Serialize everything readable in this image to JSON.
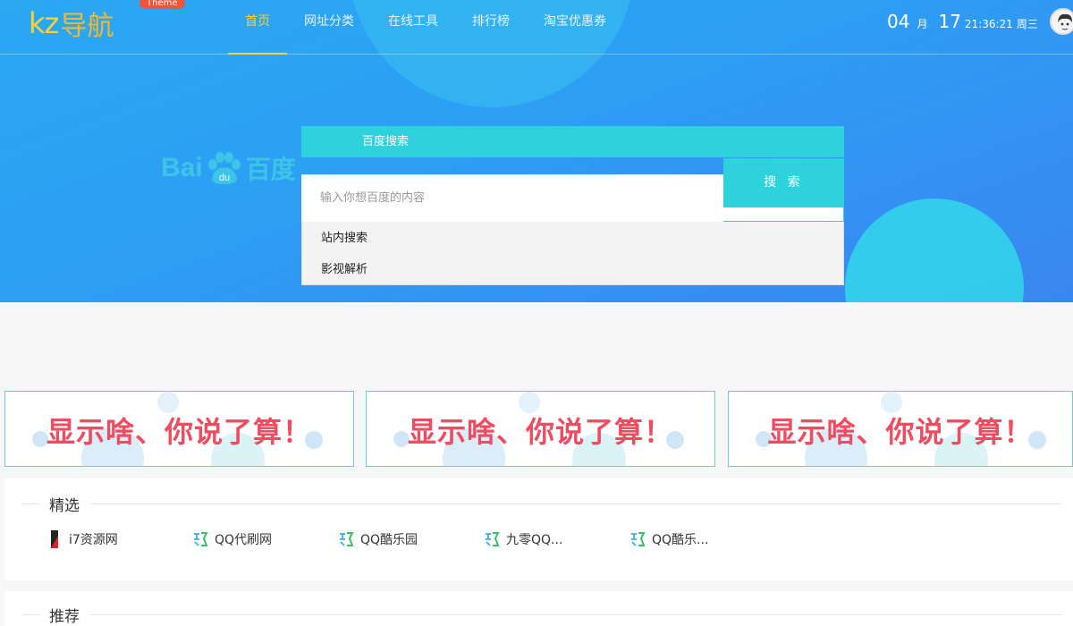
{
  "header": {
    "logo_latin": "kz",
    "logo_cn": "导航",
    "logo_badge": "Theme",
    "nav": [
      {
        "label": "首页",
        "active": true
      },
      {
        "label": "网址分类",
        "active": false
      },
      {
        "label": "在线工具",
        "active": false
      },
      {
        "label": "排行榜",
        "active": false
      },
      {
        "label": "淘宝优惠券",
        "active": false
      }
    ],
    "date": {
      "month": "04",
      "month_unit": "月",
      "day": "17",
      "time": "21:36:21",
      "weekday": "周三"
    }
  },
  "search": {
    "engine_logo_latin": "Bai",
    "engine_logo_du": "du",
    "engine_logo_cn": "百度",
    "active_tab": "百度搜索",
    "placeholder": "输入你想百度的内容",
    "button_label": "搜 索",
    "dropdown": [
      "站内搜索",
      "影视解析"
    ]
  },
  "banners": [
    {
      "text": "显示啥、你说了算！"
    },
    {
      "text": "显示啥、你说了算！"
    },
    {
      "text": "显示啥、你说了算！"
    }
  ],
  "sections": [
    {
      "title": "精选",
      "links": [
        {
          "label": "i7资源网",
          "icon": "i7-logo-icon"
        },
        {
          "label": "QQ代刷网",
          "icon": "ku-logo-icon"
        },
        {
          "label": "QQ酷乐园",
          "icon": "ku-logo-icon"
        },
        {
          "label": "九零QQ...",
          "icon": "ku-logo-icon"
        },
        {
          "label": "QQ酷乐...",
          "icon": "ku-logo-icon"
        }
      ]
    },
    {
      "title": "推荐",
      "links": []
    }
  ],
  "colors": {
    "accent": "#2dd2dc",
    "nav_active": "#f6d23a",
    "banner_text": "#f04b5f"
  }
}
